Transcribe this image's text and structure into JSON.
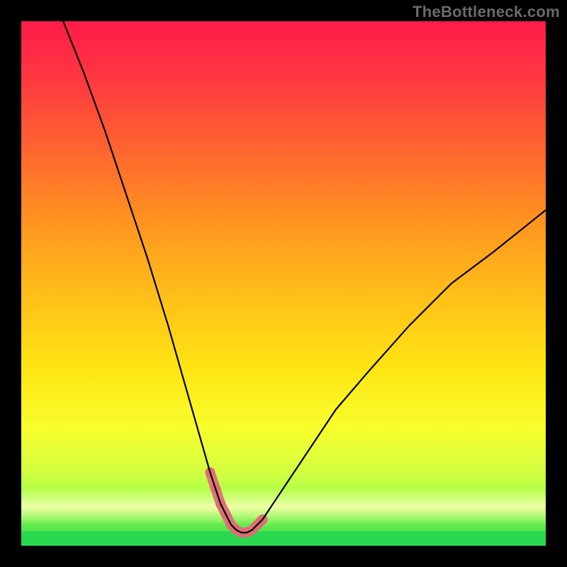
{
  "watermark": "TheBottleneck.com",
  "chart_data": {
    "type": "line",
    "title": "",
    "xlabel": "",
    "ylabel": "",
    "xlim": [
      0,
      100
    ],
    "ylim": [
      0,
      100
    ],
    "grid": false,
    "legend": false,
    "series": [
      {
        "name": "bottleneck-curve",
        "x": [
          8,
          12,
          16,
          20,
          24,
          28,
          30,
          32,
          34,
          36,
          37,
          38,
          39,
          40,
          41,
          42,
          43,
          44,
          45,
          46,
          48,
          52,
          56,
          60,
          66,
          74,
          82,
          90,
          100
        ],
        "y": [
          100,
          90,
          79,
          67,
          55,
          42,
          35,
          28,
          21,
          14,
          11,
          8,
          6,
          4,
          3,
          2.5,
          2.5,
          3,
          4,
          5,
          8,
          14,
          20,
          26,
          33,
          42,
          50,
          56,
          64
        ]
      }
    ],
    "highlight_region": {
      "name": "trough-highlight",
      "x_start": 36,
      "x_end": 47,
      "color": "#e06c75"
    },
    "background_gradient": {
      "direction": "vertical",
      "stops": [
        {
          "pos": 0.0,
          "color": "#ff1b4a"
        },
        {
          "pos": 0.12,
          "color": "#ff3b3f"
        },
        {
          "pos": 0.26,
          "color": "#ff6a2d"
        },
        {
          "pos": 0.38,
          "color": "#ff9320"
        },
        {
          "pos": 0.5,
          "color": "#ffb81a"
        },
        {
          "pos": 0.66,
          "color": "#ffe413"
        },
        {
          "pos": 0.78,
          "color": "#f6ff2d"
        },
        {
          "pos": 0.86,
          "color": "#d2ff41"
        },
        {
          "pos": 0.92,
          "color": "#9dff4d"
        },
        {
          "pos": 1.0,
          "color": "#2bd94f"
        }
      ]
    }
  }
}
